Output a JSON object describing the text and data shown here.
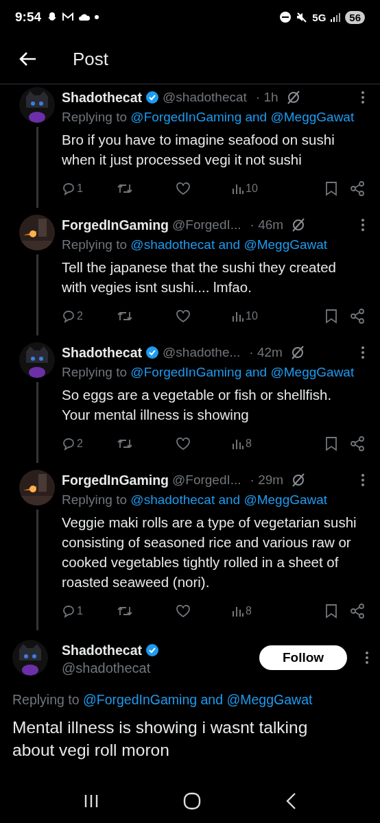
{
  "status_bar": {
    "time": "9:54",
    "network": "5G",
    "battery": "56"
  },
  "header": {
    "title": "Post"
  },
  "replies": [
    {
      "name": "Shadothecat",
      "verified": true,
      "handle": "@shadothecat",
      "time": "· 1h",
      "replying_prefix": "Replying to",
      "replying_to": "@ForgedInGaming and @MeggGawat",
      "text": "Bro if you have to imagine seafood on sushi when it just processed vegi it not sushi",
      "replies": "1",
      "views": "10"
    },
    {
      "name": "ForgedInGaming",
      "verified": false,
      "handle": "@ForgedI...",
      "time": "· 46m",
      "replying_prefix": "Replying to",
      "replying_to": "@shadothecat and @MeggGawat",
      "text": "Tell the japanese that the sushi they created with vegies isnt sushi.... lmfao.",
      "replies": "2",
      "views": "10"
    },
    {
      "name": "Shadothecat",
      "verified": true,
      "handle": "@shadothe...",
      "time": "· 42m",
      "replying_prefix": "Replying to",
      "replying_to": "@ForgedInGaming and @MeggGawat",
      "text": "So eggs are a vegetable or fish or shellfish. Your mental illness is showing",
      "replies": "2",
      "views": "8"
    },
    {
      "name": "ForgedInGaming",
      "verified": false,
      "handle": "@ForgedI...",
      "time": "· 29m",
      "replying_prefix": "Replying to",
      "replying_to": "@shadothecat and @MeggGawat",
      "text": "Veggie maki rolls are a type of vegetarian sushi consisting of seasoned rice and various raw or cooked vegetables tightly rolled in a sheet of roasted seaweed (nori).",
      "replies": "1",
      "views": "8"
    }
  ],
  "main": {
    "name": "Shadothecat",
    "verified": true,
    "handle": "@shadothecat",
    "follow": "Follow",
    "replying_prefix": "Replying to",
    "replying_to": "@ForgedInGaming and @MeggGawat",
    "text": "Mental illness is showing i wasnt talking about vegi roll moron"
  }
}
